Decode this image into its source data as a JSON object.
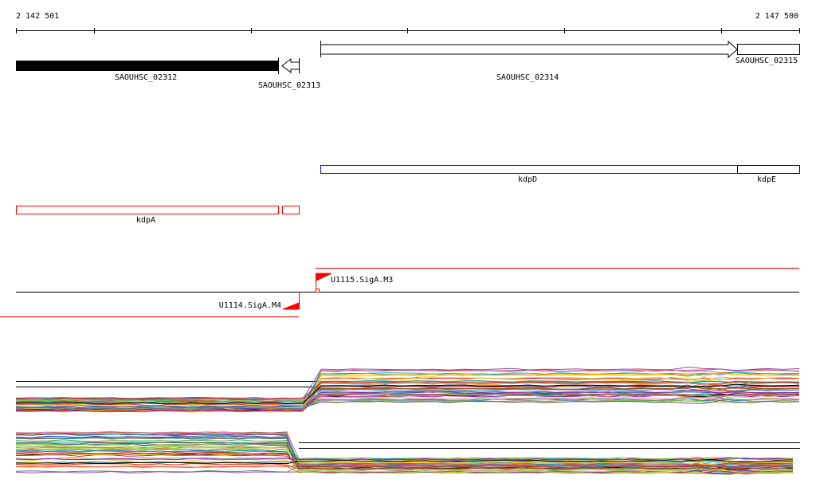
{
  "ruler": {
    "start_label": "2 142 501",
    "end_label": "2 147 500"
  },
  "genes": [
    {
      "name": "SAOUHSC_02312"
    },
    {
      "name": "SAOUHSC_02313"
    },
    {
      "name": "SAOUHSC_02314"
    },
    {
      "name": "SAOUHSC_02315"
    }
  ],
  "operons": {
    "kdpD": "kdpD",
    "kdpE": "kdpE",
    "kdpA": "kdpA"
  },
  "promoters": {
    "m3": "U1115.SigA.M3",
    "m4": "U1114.SigA.M4"
  },
  "colors": {
    "accent": "#ff0000",
    "operon_blue": "#0000ff"
  }
}
